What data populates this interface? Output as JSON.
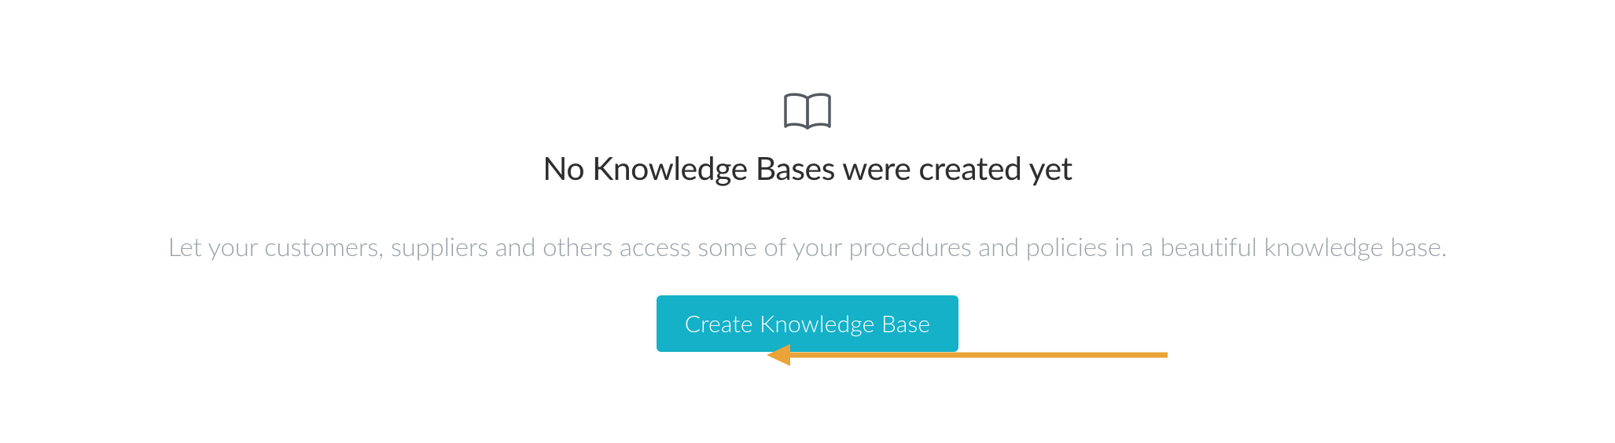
{
  "emptyState": {
    "title": "No Knowledge Bases were created yet",
    "description": "Let your customers, suppliers and others access some of your procedures and policies in a beautiful knowledge base.",
    "buttonLabel": "Create Knowledge Base"
  }
}
